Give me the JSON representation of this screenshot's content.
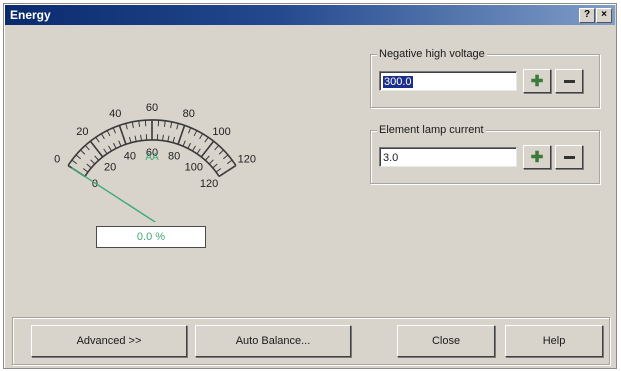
{
  "window": {
    "title": "Energy",
    "help_glyph": "?",
    "close_glyph": "×"
  },
  "gauge": {
    "outer_scale_labels": [
      "0",
      "20",
      "40",
      "60",
      "80",
      "100",
      "120"
    ],
    "inner_scale_labels": [
      "0",
      "20",
      "40",
      "60",
      "80",
      "100",
      "120"
    ],
    "unit_label": "AA",
    "needle_value": 0,
    "percent_readout": "0.0 %",
    "colors": {
      "needle": "#3fa87a",
      "scale": "#3a3a3a",
      "unit": "#3fa87a"
    }
  },
  "negative_high_voltage": {
    "label": "Negative high voltage",
    "value": "300.0",
    "increment_icon": "plus-icon",
    "decrement_icon": "minus-icon"
  },
  "element_lamp_current": {
    "label": "Element lamp current",
    "value": "3.0",
    "increment_icon": "plus-icon",
    "decrement_icon": "minus-icon"
  },
  "buttons": {
    "advanced": "Advanced >>",
    "auto_balance": "Auto Balance...",
    "close": "Close",
    "help": "Help"
  }
}
